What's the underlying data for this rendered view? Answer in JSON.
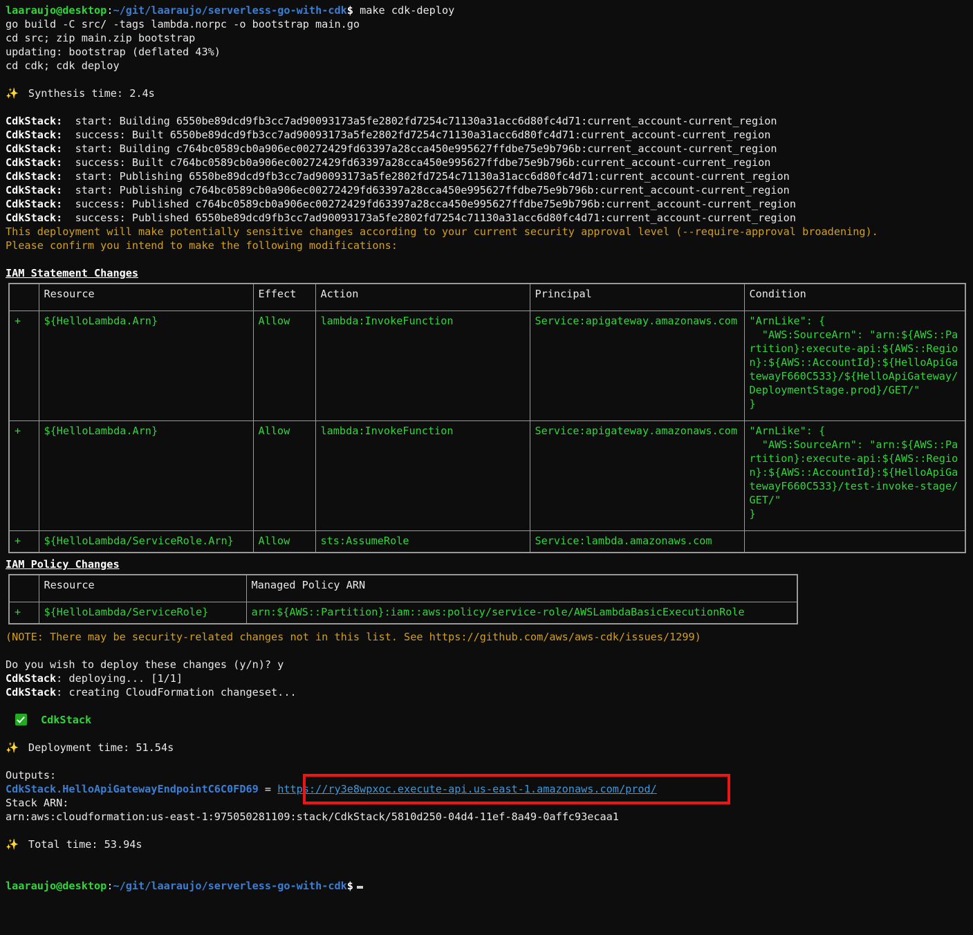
{
  "terminal": {
    "prompt": {
      "user_host": "laaraujo@desktop",
      "colon": ":",
      "path": "~/git/laaraujo/serverless-go-with-cdk",
      "sigil": "$",
      "command": " make cdk-deploy"
    },
    "build_lines": [
      "go build -C src/ -tags lambda.norpc -o bootstrap main.go",
      "cd src; zip main.zip bootstrap",
      "updating: bootstrap (deflated 43%)",
      "cd cdk; cdk deploy"
    ],
    "synthesis_icon": "sparkles-icon",
    "synthesis_time": "Synthesis time: 2.4s",
    "asset_lines": [
      {
        "stack": "CdkStack:",
        "text": "  start: Building 6550be89dcd9fb3cc7ad90093173a5fe2802fd7254c71130a31acc6d80fc4d71:current_account-current_region"
      },
      {
        "stack": "CdkStack:",
        "text": "  success: Built 6550be89dcd9fb3cc7ad90093173a5fe2802fd7254c71130a31acc6d80fc4d71:current_account-current_region"
      },
      {
        "stack": "CdkStack:",
        "text": "  start: Building c764bc0589cb0a906ec00272429fd63397a28cca450e995627ffdbe75e9b796b:current_account-current_region"
      },
      {
        "stack": "CdkStack:",
        "text": "  success: Built c764bc0589cb0a906ec00272429fd63397a28cca450e995627ffdbe75e9b796b:current_account-current_region"
      },
      {
        "stack": "CdkStack:",
        "text": "  start: Publishing 6550be89dcd9fb3cc7ad90093173a5fe2802fd7254c71130a31acc6d80fc4d71:current_account-current_region"
      },
      {
        "stack": "CdkStack:",
        "text": "  start: Publishing c764bc0589cb0a906ec00272429fd63397a28cca450e995627ffdbe75e9b796b:current_account-current_region"
      },
      {
        "stack": "CdkStack:",
        "text": "  success: Published c764bc0589cb0a906ec00272429fd63397a28cca450e995627ffdbe75e9b796b:current_account-current_region"
      },
      {
        "stack": "CdkStack:",
        "text": "  success: Published 6550be89dcd9fb3cc7ad90093173a5fe2802fd7254c71130a31acc6d80fc4d71:current_account-current_region"
      }
    ],
    "warning_line_1": "This deployment will make potentially sensitive changes according to your current security approval level (--require-approval broadening).",
    "warning_line_2": "Please confirm you intend to make the following modifications:",
    "iam_statement_changes": {
      "heading": "IAM Statement Changes",
      "columns": [
        "",
        "Resource",
        "Effect",
        "Action",
        "Principal",
        "Condition"
      ],
      "rows": [
        {
          "change": "+",
          "resource": "${HelloLambda.Arn}",
          "effect": "Allow",
          "action": "lambda:InvokeFunction",
          "principal": "Service:apigateway.amazonaws.com",
          "condition": "\"ArnLike\": {\n  \"AWS:SourceArn\": \"arn:${AWS::Partition}:execute-api:${AWS::Region}:${AWS::AccountId}:${HelloApiGatewayF660C533}/${HelloApiGateway/DeploymentStage.prod}/GET/\"\n}"
        },
        {
          "change": "+",
          "resource": "${HelloLambda.Arn}",
          "effect": "Allow",
          "action": "lambda:InvokeFunction",
          "principal": "Service:apigateway.amazonaws.com",
          "condition": "\"ArnLike\": {\n  \"AWS:SourceArn\": \"arn:${AWS::Partition}:execute-api:${AWS::Region}:${AWS::AccountId}:${HelloApiGatewayF660C533}/test-invoke-stage/GET/\"\n}"
        },
        {
          "change": "+",
          "resource": "${HelloLambda/ServiceRole.Arn}",
          "effect": "Allow",
          "action": "sts:AssumeRole",
          "principal": "Service:lambda.amazonaws.com",
          "condition": ""
        }
      ]
    },
    "iam_policy_changes": {
      "heading": "IAM Policy Changes",
      "columns": [
        "",
        "Resource",
        "Managed Policy ARN"
      ],
      "rows": [
        {
          "change": "+",
          "resource": "${HelloLambda/ServiceRole}",
          "managed_policy_arn": "arn:${AWS::Partition}:iam::aws:policy/service-role/AWSLambdaBasicExecutionRole"
        }
      ]
    },
    "note_line": "(NOTE: There may be security-related changes not in this list. See https://github.com/aws/aws-cdk/issues/1299)",
    "confirm_prompt": "Do you wish to deploy these changes (y/n)? y",
    "deploy_lines": [
      {
        "stack": "CdkStack",
        "text": ": deploying... [1/1]"
      },
      {
        "stack": "CdkStack",
        "text": ": creating CloudFormation changeset..."
      }
    ],
    "success": {
      "icon": "check-mark-button-icon",
      "stack_name": "CdkStack"
    },
    "deployment_time": "Deployment time: 51.54s",
    "outputs": {
      "label": "Outputs:",
      "key": "CdkStack.HelloApiGatewayEndpointC6C0FD69",
      "equals": " = ",
      "url": "https://ry3e8wpxoc.execute-api.us-east-1.amazonaws.com/prod/",
      "highlight_color": "#f01414"
    },
    "stack_arn_label": "Stack ARN:",
    "stack_arn": "arn:aws:cloudformation:us-east-1:975050281109:stack/CdkStack/5810d250-04d4-11ef-8a49-0affc93ecaa1",
    "total_time": "Total time: 53.94s",
    "final_prompt": {
      "user_host": "laaraujo@desktop",
      "colon": ":",
      "path": "~/git/laaraujo/serverless-go-with-cdk",
      "sigil": "$"
    }
  }
}
